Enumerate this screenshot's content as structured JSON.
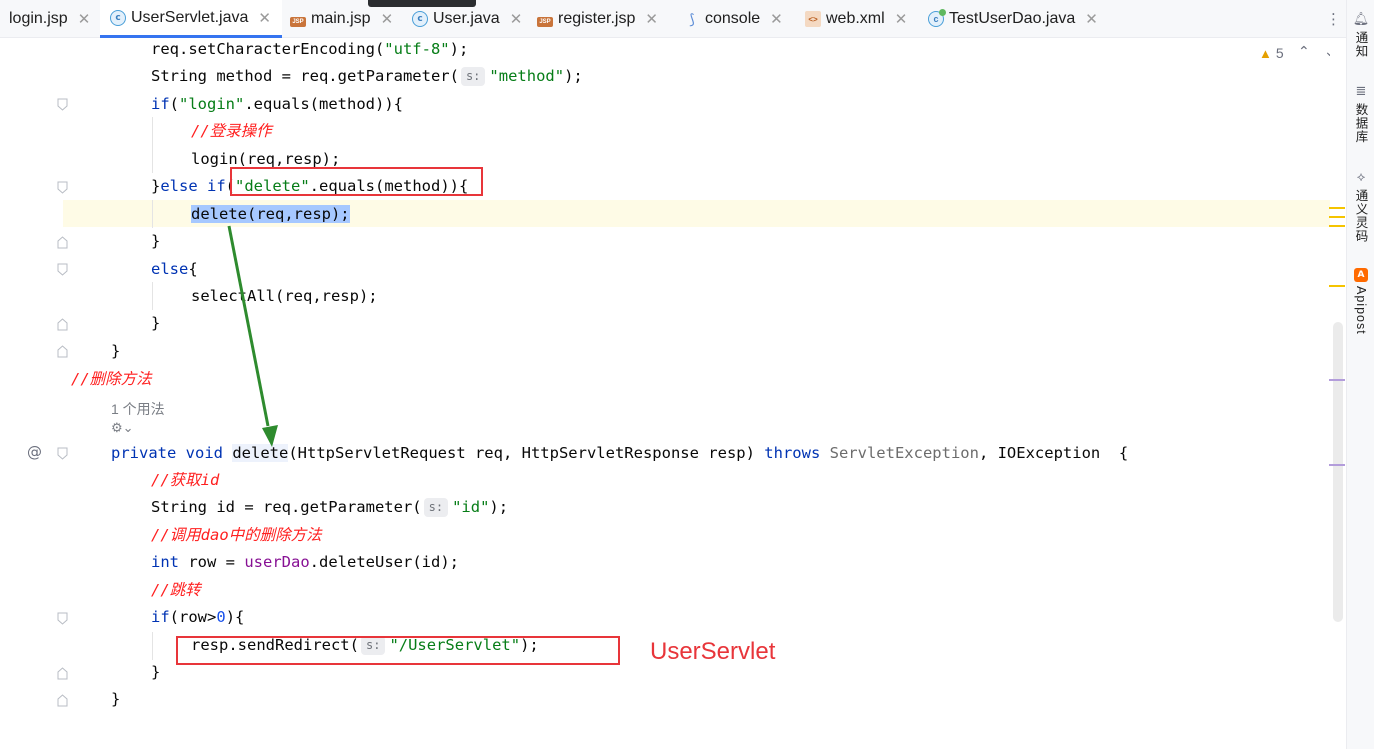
{
  "tabs": [
    {
      "label": "login.jsp",
      "icon": "jsp-file-icon"
    },
    {
      "label": "UserServlet.java",
      "icon": "java-class-icon",
      "active": true
    },
    {
      "label": "main.jsp",
      "icon": "jsp-file-icon"
    },
    {
      "label": "User.java",
      "icon": "java-class-icon"
    },
    {
      "label": "register.jsp",
      "icon": "jsp-file-icon"
    },
    {
      "label": "console",
      "icon": "console-icon"
    },
    {
      "label": "web.xml",
      "icon": "xml-file-icon"
    },
    {
      "label": "TestUserDao.java",
      "icon": "test-class-icon"
    }
  ],
  "editor": {
    "warnings_count": "5",
    "code": {
      "l1_a": "req.setCharacterEncoding(",
      "l1_str": "\"utf-8\"",
      "l1_b": ");",
      "l2_a": "String method = req.getParameter(",
      "l2_hint": "s:",
      "l2_str": "\"method\"",
      "l2_b": ");",
      "l3_kw": "if",
      "l3_a": "(",
      "l3_str": "\"login\"",
      "l3_b": ".equals(method)){",
      "l4_cmt": "//登录操作",
      "l5": "login(req,resp);",
      "l6_a": "}",
      "l6_kw": "else if",
      "l6_b": "(",
      "l6_str": "\"delete\"",
      "l6_c": ".equals(method)){",
      "l7": "delete(req,resp);",
      "l8": "}",
      "l9_kw": "else",
      "l9_b": "{",
      "l10": "selectAll(req,resp);",
      "l11": "}",
      "l12": "}",
      "l13_cmt": "//删除方法",
      "l14_usage": "1 个用法",
      "l15_kw1": "private",
      "l15_kw2": "void",
      "l15_name": "delete",
      "l15_a": "(HttpServletRequest req, HttpServletResponse resp)",
      "l15_kw3": "throws",
      "l15_exc1": "ServletException",
      "l15_b": ", IOException  {",
      "l16_cmt": "//获取id",
      "l17_a": "String id = req.getParameter(",
      "l17_hint": "s:",
      "l17_str": "\"id\"",
      "l17_b": ");",
      "l18_cmt": "//调用dao中的删除方法",
      "l19_kw": "int",
      "l19_a": "row = ",
      "l19_fld": "userDao",
      "l19_b": ".deleteUser(id);",
      "l20_cmt": "//跳转",
      "l21_kw": "if",
      "l21_a": "(row>",
      "l21_num": "0",
      "l21_b": "){",
      "l22_a": "resp.sendRedirect(",
      "l22_hint": "s:",
      "l22_str": "\"/UserServlet\"",
      "l22_b": ");",
      "l23": "}",
      "l24": "}"
    }
  },
  "annotation": {
    "text": "UserServlet",
    "color": "#e8353a",
    "arrow_color": "#2e8b2e"
  },
  "sidebar": {
    "items": [
      {
        "label": "通知",
        "icon": "bell-icon"
      },
      {
        "label": "数据库",
        "icon": "database-icon"
      },
      {
        "label": "通义灵码",
        "icon": "ai-assistant-icon"
      },
      {
        "label": "Apipost",
        "icon": "apipost-icon"
      }
    ]
  }
}
